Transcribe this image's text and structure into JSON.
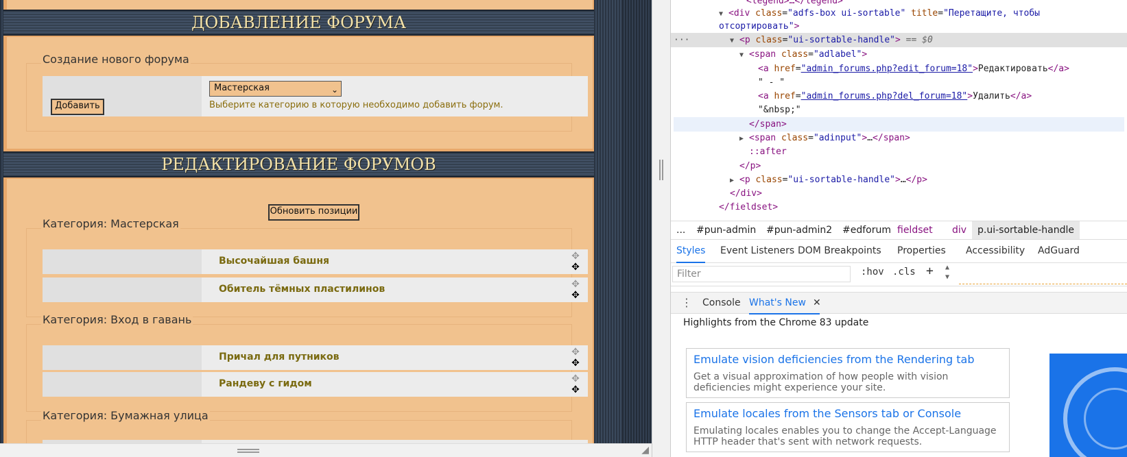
{
  "page": {
    "add_section": {
      "title": "ДОБАВЛЕНИЕ ФОРУМА",
      "legend": "Создание нового форума",
      "add_button": "Добавить",
      "category_select": "Мастерская",
      "hint": "Выберите категорию в которую необходимо добавить форум."
    },
    "edit_section": {
      "title": "РЕДАКТИРОВАНИЕ ФОРУМОВ",
      "update_button": "Обновить позиции",
      "categories": [
        {
          "legend": "Категория: Мастерская",
          "forums": [
            "Высочайшая башня",
            "Обитель тёмных пластилинов"
          ]
        },
        {
          "legend": "Категория: Вход в гавань",
          "forums": [
            "Причал для путников",
            "Рандеву с гидом"
          ]
        },
        {
          "legend": "Категория: Бумажная улица",
          "forums": []
        }
      ]
    }
  },
  "devtools": {
    "elements": {
      "l0_text": "<legend>…</legend>",
      "l1": {
        "tag": "div",
        "class_attr": "class",
        "class_val": "\"adfs-box ui-sortable\"",
        "title_attr": "title",
        "title_val": "\"Перетащите, чтобы",
        "title_cont": "отсортировать\""
      },
      "l3": {
        "tag": "p",
        "class_val": "\"ui-sortable-handle\"",
        "suffix": "== $0",
        "ellipsis": "···"
      },
      "l4": {
        "tag": "span",
        "class_val": "\"adlabel\""
      },
      "l5": {
        "href": "\"admin_forums.php?edit_forum=18\"",
        "text": "Редактировать"
      },
      "l6_text": "\" - \"",
      "l7": {
        "href": "\"admin_forums.php?del_forum=18\"",
        "text": "Удалить"
      },
      "l8_text": "\"&nbsp;\"",
      "l9_text": "</span>",
      "l10": {
        "class_val": "\"adinput\"",
        "inner": "…"
      },
      "l11_text": "::after",
      "l12_text": "</p>",
      "l13": {
        "class_val": "\"ui-sortable-handle\"",
        "inner": "…"
      },
      "l14_text": "</div>",
      "l15_text": "</fieldset>"
    },
    "breadcrumbs": [
      "...",
      "#pun-admin",
      "#pun-admin2",
      "#edforum",
      "fieldset",
      "div",
      "p.ui-sortable-handle"
    ],
    "style_tabs": [
      "Styles",
      "Event Listeners",
      "DOM Breakpoints",
      "Properties",
      "Accessibility",
      "AdGuard"
    ],
    "filter_placeholder": "Filter",
    "filter_tools": [
      ":hov",
      ".cls",
      "+"
    ],
    "drawer_tabs": [
      "Console",
      "What's New"
    ],
    "whats_new": {
      "header": "Highlights from the Chrome 83 update",
      "cards": [
        {
          "title": "Emulate vision deficiencies from the Rendering tab",
          "desc": "Get a visual approximation of how people with vision deficiencies might experience your site."
        },
        {
          "title": "Emulate locales from the Sensors tab or Console",
          "desc": "Emulating locales enables you to change the Accept-Language HTTP header that's sent with network requests."
        }
      ]
    }
  },
  "colors": {
    "accent": "#1a73e8",
    "page_bg": "#f1c28e",
    "link_gold": "#7a6a10"
  },
  "icons": [
    "move-icon",
    "close-icon",
    "more-icon",
    "dropdown-caret-icon",
    "resize-grip-icon"
  ]
}
